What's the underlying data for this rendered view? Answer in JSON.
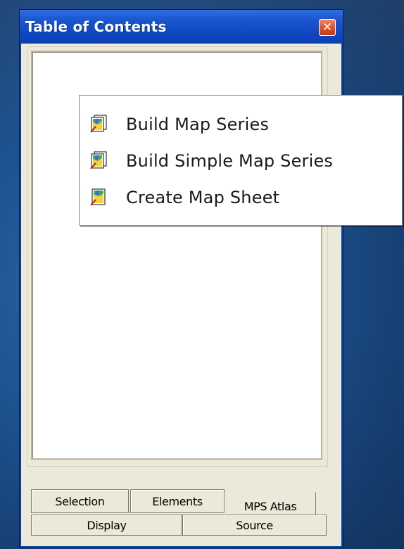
{
  "window": {
    "title": "Table of Contents",
    "close_icon": "close-icon",
    "close_glyph": "✕"
  },
  "tabs": {
    "row1": [
      {
        "label": "Selection",
        "selected": false
      },
      {
        "label": "Elements",
        "selected": false
      },
      {
        "label": "MPS Atlas",
        "selected": true
      }
    ],
    "row2": [
      {
        "label": "Display",
        "selected": false
      },
      {
        "label": "Source",
        "selected": false
      }
    ]
  },
  "context_menu": {
    "items": [
      {
        "label": "Build Map Series",
        "icon": "map-series-icon"
      },
      {
        "label": "Build Simple Map Series",
        "icon": "map-series-icon"
      },
      {
        "label": "Create Map Sheet",
        "icon": "map-sheet-icon"
      }
    ]
  },
  "colors": {
    "titlebar": "#0f47c2",
    "window_face": "#ece9d8",
    "desktop": "#1e5494",
    "close_button": "#e0532c"
  }
}
